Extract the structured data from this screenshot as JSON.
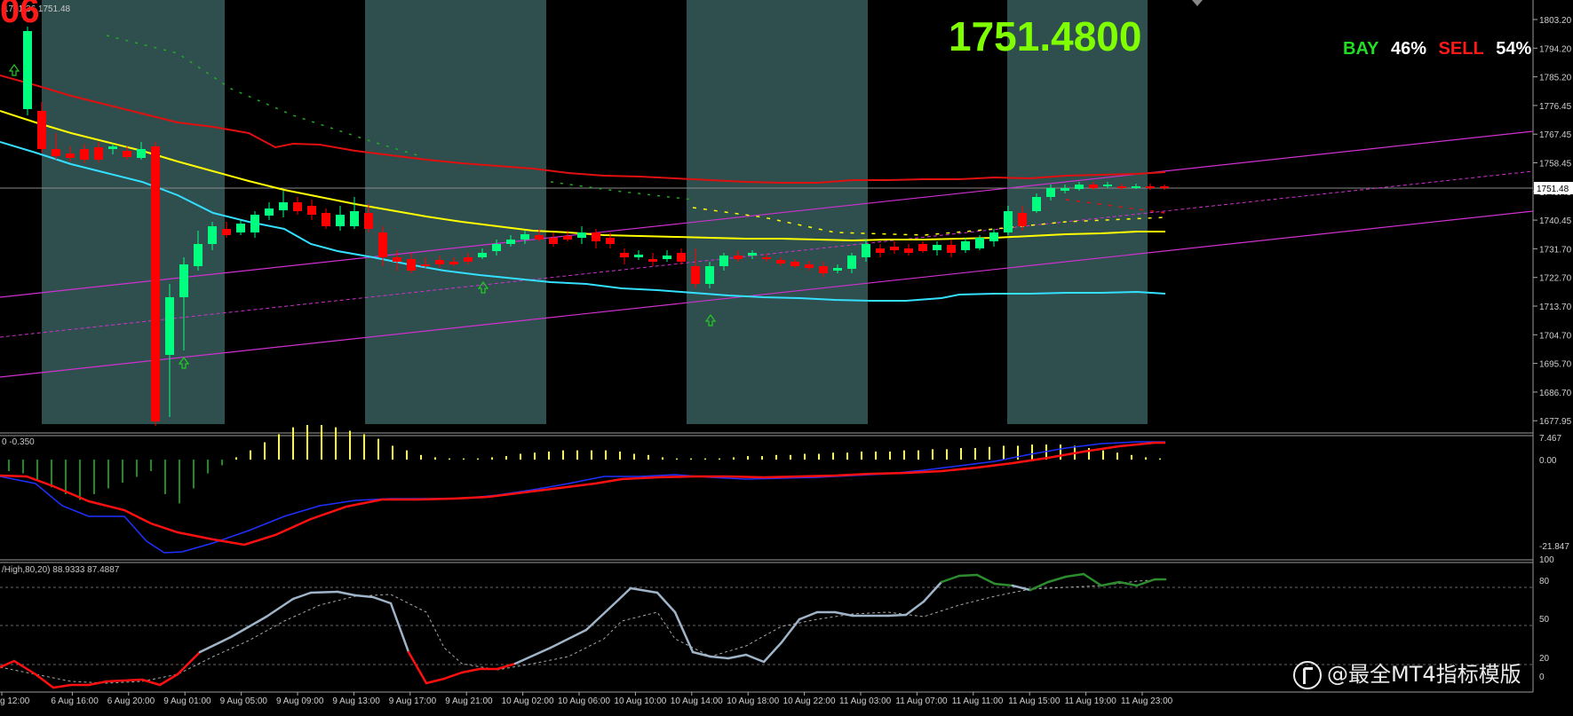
{
  "main_chart": {
    "header": "1751.36 1751.48",
    "current_price": "1751.4800",
    "price_tag": "1751.48",
    "corner_label": "06",
    "price_axis": [
      "1803.20",
      "1794.20",
      "1785.20",
      "1776.45",
      "1767.45",
      "1758.45",
      "1749.45",
      "1740.45",
      "1731.70",
      "1722.70",
      "1713.70",
      "1704.70",
      "1695.70",
      "1686.70",
      "1677.95"
    ],
    "sentiment": {
      "buy_label": "BAY",
      "buy_pct": "46%",
      "sell_label": "SELL",
      "sell_pct": "54%",
      "buy_color": "#22dd22",
      "sell_color": "#ff1a1a"
    }
  },
  "macd_panel": {
    "header": "0 -0.350",
    "axis": [
      "7.467",
      "0.00",
      "-21.847"
    ]
  },
  "stoch_panel": {
    "header": "/High,80,20) 88.9333 87.4887",
    "axis": [
      "100",
      "80",
      "50",
      "20",
      "0"
    ]
  },
  "time_axis": [
    "g 12:00",
    "6 Aug 16:00",
    "6 Aug 20:00",
    "9 Aug 01:00",
    "9 Aug 05:00",
    "9 Aug 09:00",
    "9 Aug 13:00",
    "9 Aug 17:00",
    "9 Aug 21:00",
    "10 Aug 02:00",
    "10 Aug 06:00",
    "10 Aug 10:00",
    "10 Aug 14:00",
    "10 Aug 18:00",
    "10 Aug 22:00",
    "11 Aug 03:00",
    "11 Aug 07:00",
    "11 Aug 11:00",
    "11 Aug 15:00",
    "11 Aug 19:00",
    "11 Aug 23:00"
  ],
  "watermark": "@最全MT4指标模版",
  "colors": {
    "background": "#000000",
    "session_shade": "#2f4f4f",
    "bull_candle": "#00ff7f",
    "bear_candle": "#ff0000",
    "ma_red": "#e01010",
    "ma_yellow": "#ffff00",
    "ma_cyan": "#33e0ff",
    "channel": "#d030d0",
    "big_price": "#7fff00"
  }
}
